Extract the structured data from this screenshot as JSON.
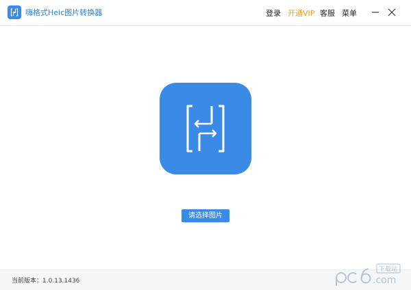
{
  "app": {
    "title": "嗨格式Heic图片转换器"
  },
  "menu": {
    "login": "登录",
    "vip": "开通VIP",
    "support": "客服",
    "more": "菜单"
  },
  "main": {
    "select_button": "请选择图片"
  },
  "footer": {
    "version": "当前版本：1.0.13.1436"
  },
  "colors": {
    "accent": "#3b8be6",
    "vip": "#f39c12"
  }
}
